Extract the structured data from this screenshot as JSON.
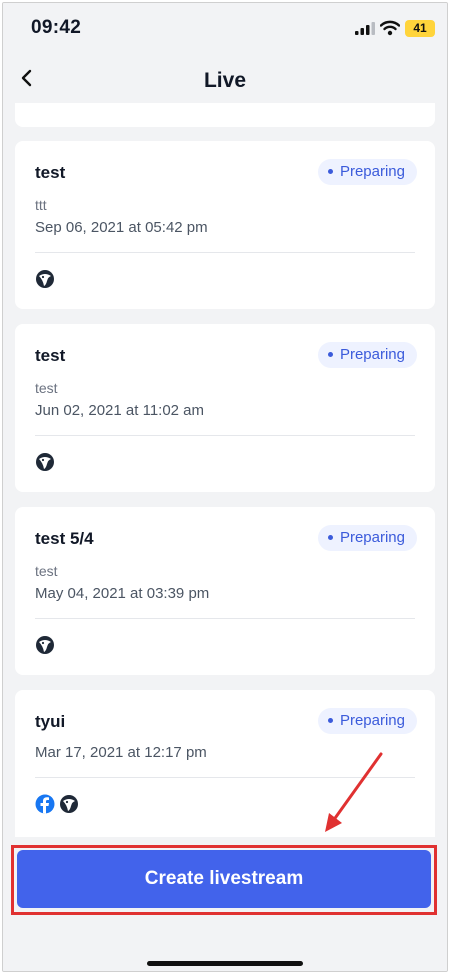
{
  "status_bar": {
    "time": "09:42",
    "battery": "41"
  },
  "header": {
    "title": "Live"
  },
  "cards": [
    {
      "title": "test",
      "status": "Preparing",
      "description": "ttt",
      "date": "Sep 06, 2021 at 05:42 pm",
      "platforms": [
        "bird-icon"
      ]
    },
    {
      "title": "test",
      "status": "Preparing",
      "description": "test",
      "date": "Jun 02, 2021 at 11:02 am",
      "platforms": [
        "bird-icon"
      ]
    },
    {
      "title": "test 5/4",
      "status": "Preparing",
      "description": "test",
      "date": "May 04, 2021 at 03:39 pm",
      "platforms": [
        "bird-icon"
      ]
    },
    {
      "title": "tyui",
      "status": "Preparing",
      "description": "",
      "date": "Mar 17, 2021 at 12:17 pm",
      "platforms": [
        "facebook-icon",
        "bird-icon"
      ]
    }
  ],
  "cta": {
    "label": "Create livestream"
  },
  "colors": {
    "accent": "#4263eb",
    "badge_text": "#3b5bdb",
    "badge_bg": "#eef2ff",
    "annotation": "#e03131"
  }
}
